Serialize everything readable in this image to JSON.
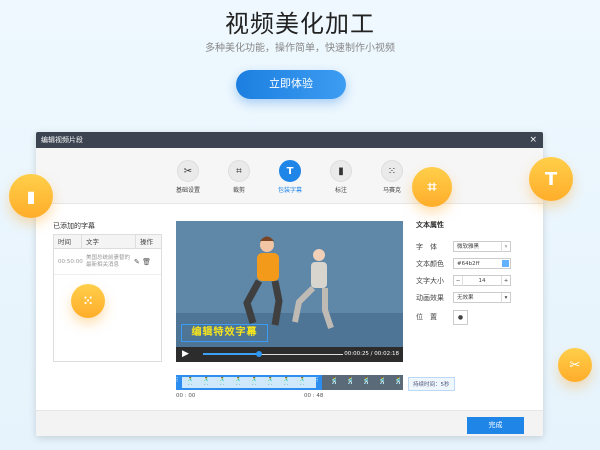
{
  "hero": {
    "title": "视频美化加工",
    "subtitle": "多种美化功能，操作简单，快速制作小视频",
    "cta": "立即体验"
  },
  "dialog": {
    "title": "编辑视频片段",
    "close": "×",
    "tools": [
      {
        "label": "基础设置",
        "icon": "scissors"
      },
      {
        "label": "裁剪",
        "icon": "crop"
      },
      {
        "label": "包装字幕",
        "icon": "text"
      },
      {
        "label": "标注",
        "icon": "bookmark"
      },
      {
        "label": "马赛克",
        "icon": "mosaic"
      }
    ],
    "active_tool": 2,
    "subtitles": {
      "label": "已添加的字幕",
      "headers": [
        "时间",
        "文字",
        "操作"
      ],
      "rows": [
        {
          "time": "00:50:00",
          "text": "美国总统前妻替的最新相关消息"
        }
      ]
    },
    "video": {
      "caption": "编辑特效字幕",
      "time": "00:00:25 / 00:02:18",
      "progress": 0.4
    },
    "timeline": {
      "start": "00 : 00",
      "end": "00 : 48",
      "duration": "持续时间：5秒"
    },
    "props": {
      "label": "文本属性",
      "font_label": "字　体",
      "font": "微软雅黑",
      "color_label": "文本颜色",
      "color": "#64b2ff",
      "size_label": "文字大小",
      "size": "14",
      "minus": "−",
      "plus": "+",
      "anim_label": "动画效果",
      "anim": "无效果",
      "pos_label": "位　置"
    },
    "done": "完成"
  },
  "colors": {
    "accent": "#1f86e8",
    "orb": "#ffb830"
  }
}
